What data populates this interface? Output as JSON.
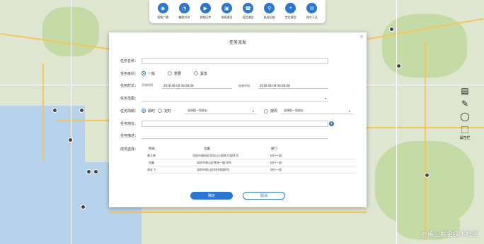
{
  "toolbar": [
    {
      "icon": "broadcast-icon",
      "label": "视频广播"
    },
    {
      "icon": "speaker-icon",
      "label": "集群对讲"
    },
    {
      "icon": "video-call-icon",
      "label": "视频回传"
    },
    {
      "icon": "monitor-icon",
      "label": "电视通话"
    },
    {
      "icon": "voice-call-icon",
      "label": "语音通话"
    },
    {
      "icon": "track-icon",
      "label": "轨迹回放"
    },
    {
      "icon": "location-icon",
      "label": "定位模型"
    },
    {
      "icon": "dispatch-icon",
      "label": "指令下达"
    }
  ],
  "dialog": {
    "title": "任务派发",
    "close": "×",
    "task_name_label": "任务名称：",
    "task_level_label": "任务级别：",
    "levels": [
      "一般",
      "重要",
      "紧急"
    ],
    "task_time_label": "任务时长：",
    "start_label": "开始时间",
    "start_value": "2018-08-08  08:08:08",
    "end_label": "结束时间",
    "end_value": "2018-08-08  08:08:08",
    "task_range_label": "任务范围：",
    "task_type_label": "任务周期：",
    "types": [
      "即时",
      "定时",
      "按周"
    ],
    "week_range_a": "双休假一到周五",
    "week_range_b": "双休假一到周五",
    "task_address_label": "任务地址：",
    "task_desc_label": "任务描述：",
    "staff_label": "成员选择：",
    "table": {
      "headers": [
        "姓名",
        "位置",
        "部门"
      ],
      "rows": [
        [
          "黄玉林",
          "深圳市福田区莲花山公园南大道01号",
          "执行一部"
        ],
        [
          "张鑫",
          "深圳市南山区粤海一路18号",
          "执行一部"
        ],
        [
          "胡友飞",
          "深圳市南山区科技南路8号",
          "执行一部"
        ]
      ]
    },
    "ok": "确定",
    "cancel": "取消"
  },
  "right_tools": {
    "label": "属性栏"
  },
  "watermark": "@稀土掘金技术社区",
  "colors": {
    "accent": "#2b76d2",
    "sea": "#b7d2ec",
    "land": "#dfe6cf"
  }
}
